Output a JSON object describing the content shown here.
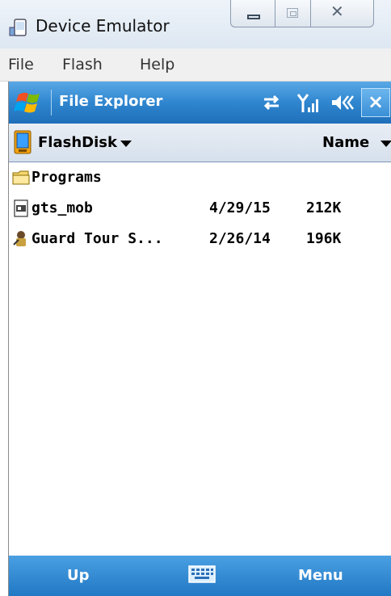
{
  "window": {
    "title": "Device Emulator",
    "controls": {
      "minimize_icon": "minimize-icon",
      "maximize_icon": "maximize-icon",
      "close_icon": "close-icon"
    }
  },
  "menubar": {
    "items": [
      "File",
      "Flash",
      "Help"
    ]
  },
  "device": {
    "titlebar": {
      "title": "File Explorer",
      "accent": "#2f86cf"
    },
    "pathbar": {
      "location": "FlashDisk",
      "sort": "Name"
    },
    "files": [
      {
        "name": "Programs",
        "date": "",
        "size": "",
        "icon": "folder-icon"
      },
      {
        "name": "gts_mob",
        "date": "4/29/15",
        "size": "212K",
        "icon": "executable-file-icon"
      },
      {
        "name": "Guard Tour S...",
        "date": "2/26/14",
        "size": "196K",
        "icon": "application-icon"
      }
    ],
    "softkeys": {
      "left": "Up",
      "right": "Menu"
    }
  }
}
